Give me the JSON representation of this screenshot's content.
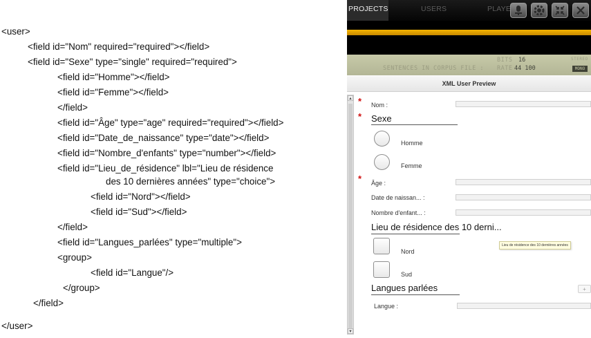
{
  "xml_lines": [
    "<user>",
    "<field id=\"Nom\" required=\"required\"></field>",
    "<field id=\"Sexe\" type=\"single\" required=\"required\">",
    "<field id=\"Homme\"></field>",
    "<field id=\"Femme\"></field>",
    "</field>",
    "<field id=\"Âge\" type=\"age\" required=\"required\"></field>",
    "<field id=\"Date_de_naissance\" type=\"date\"></field>",
    "<field id=\"Nombre_d'enfants\" type=\"number\"></field>",
    "<field id=\"Lieu_de_résidence\" lbl=\"Lieu de résidence",
    "des 10 dernières années\" type=\"choice\">",
    "<field id=\"Nord\"></field>",
    "<field id=\"Sud\"></field>",
    "</field>",
    "<field id=\"Langues_parlées\" type=\"multiple\">",
    "<group>",
    "<field id=\"Langue\"/>",
    "</group>",
    "</field>",
    "</user>"
  ],
  "app": {
    "tabs": {
      "projects": "PROJECTS",
      "users": "USERS",
      "player": "PLAYER"
    },
    "toolbar_icons": [
      "mic-icon",
      "gear-icon",
      "compress-icon",
      "close-icon"
    ],
    "progress": 1.0,
    "status": {
      "sentences_label": "SENTENCES IN CORPUS FILE :",
      "bits_label": "BITS",
      "bits_value": "16",
      "rate_label": "RATE",
      "rate_value": "44 100",
      "stereo_label": "STEREO",
      "mono_label": "MONO"
    },
    "preview_title": "XML User Preview",
    "form": {
      "nom_label": "Nom :",
      "sexe_title": "Sexe",
      "homme_label": "Homme",
      "femme_label": "Femme",
      "age_label": "Âge :",
      "date_label": "Date de naissan... :",
      "enfants_label": "Nombre d'enfant... :",
      "lieu_title": "Lieu de résidence des 10 derni...",
      "lieu_tooltip": "Lieu de résidence des 10 dernières années",
      "nord_label": "Nord",
      "sud_label": "Sud",
      "langues_title": "Langues parlées",
      "add_label": "+",
      "langue_label": "Langue :"
    },
    "colors": {
      "accent": "#f5b400",
      "required": "#d01010",
      "status_bg": "#c7c9a8"
    }
  }
}
